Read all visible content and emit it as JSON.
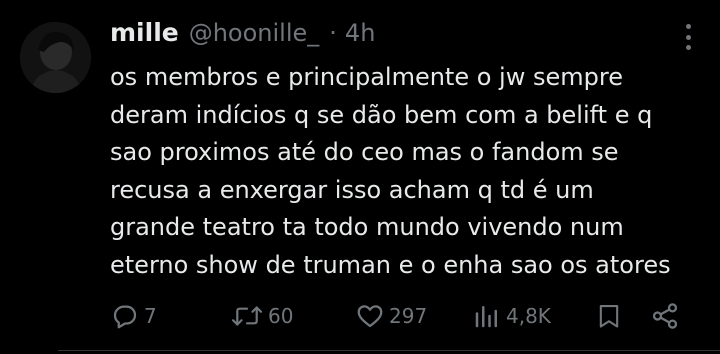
{
  "tweet": {
    "author_name": "mille",
    "author_handle": "@hoonille_",
    "separator": "·",
    "timestamp": "4h",
    "text_lines": [
      "os membros e principalmente o jw sempre",
      "deram indícios q se dão bem com a belift e q",
      "sao proximos até do ceo mas o fandom se",
      "recusa a enxergar isso acham q td é um",
      "grande teatro ta todo mundo vivendo num",
      "eterno show de truman e o enha sao os atores"
    ]
  },
  "actions": {
    "replies": "7",
    "reposts": "60",
    "likes": "297",
    "views": "4,8K"
  },
  "icons": {
    "more": "more-dots-icon",
    "reply": "reply-bubble-icon",
    "repost": "repost-arrows-icon",
    "like": "heart-icon",
    "views": "bar-chart-icon",
    "bookmark": "bookmark-icon",
    "share": "share-icon"
  },
  "colors": {
    "background": "#000000",
    "text": "#e7e9ea",
    "secondary": "#71767b"
  }
}
